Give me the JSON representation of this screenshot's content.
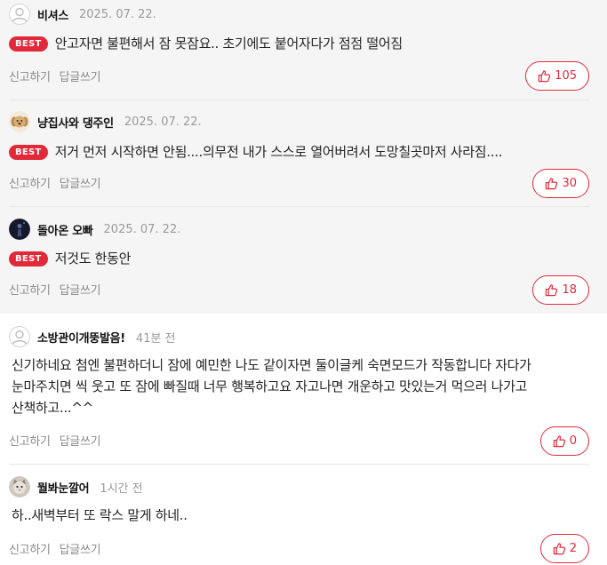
{
  "actions": {
    "report": "신고하기",
    "reply": "답글쓰기"
  },
  "badge_label": "BEST",
  "colors": {
    "accent": "#e2293a",
    "best_bg": "#f5f5f5"
  },
  "comments": [
    {
      "nickname": "비셔스",
      "date": "2025. 07. 22.",
      "best": true,
      "avatar_icon": "default-avatar-icon",
      "text": "안고자면 불편해서 잠 못잠요.. 초기에도 붙어자다가 점점 떨어짐",
      "likes": "105"
    },
    {
      "nickname": "냥집사와 댕주인",
      "date": "2025. 07. 22.",
      "best": true,
      "avatar_icon": "puppy-avatar-icon",
      "text": "저거 먼저 시작하면 안됨....의무전 내가 스스로 열어버려서 도망칠곳마저 사라짐....",
      "likes": "30"
    },
    {
      "nickname": "돌아온 오빠",
      "date": "2025. 07. 22.",
      "best": true,
      "avatar_icon": "dark-figure-avatar-icon",
      "text": "저것도 한동안",
      "likes": "18"
    },
    {
      "nickname": "소방관이개뚱발음!",
      "date": "41분 전",
      "best": false,
      "avatar_icon": "default-avatar-icon",
      "text": "신기하네요 첨엔 불편하더니 잠에 예민한 나도 같이자면 둘이글케 숙면모드가 작동합니다 자다가 눈마주치면 씩 웃고 또 잠에 빠질때 너무 행복하고요 자고나면 개운하고 맛있는거 먹으러 나가고 산책하고...^^",
      "likes": "0"
    },
    {
      "nickname": "뭘봐눈깔어",
      "date": "1시간 전",
      "best": false,
      "avatar_icon": "cat-avatar-icon",
      "text": "하..새벽부터 또 락스 말게 하네..",
      "likes": "2"
    }
  ]
}
